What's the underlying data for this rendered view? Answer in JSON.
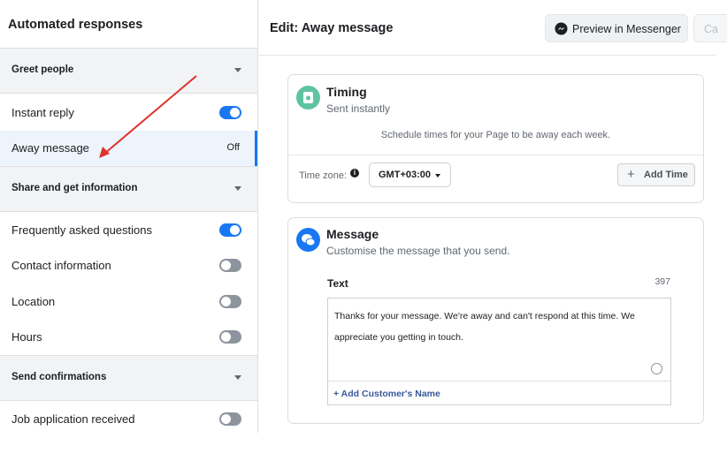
{
  "sidebar": {
    "title": "Automated responses",
    "sections": [
      {
        "label": "Greet people"
      },
      {
        "label": "Share and get information"
      },
      {
        "label": "Send confirmations"
      }
    ],
    "items": [
      {
        "label": "Instant reply",
        "toggle": "on"
      },
      {
        "label": "Away message",
        "status": "Off",
        "selected": true
      },
      {
        "label": "Frequently asked questions",
        "toggle": "on"
      },
      {
        "label": "Contact information",
        "toggle": "off"
      },
      {
        "label": "Location",
        "toggle": "off"
      },
      {
        "label": "Hours",
        "toggle": "off"
      },
      {
        "label": "Job application received",
        "toggle": "off"
      }
    ]
  },
  "header": {
    "title": "Edit: Away message",
    "preview_label": "Preview in Messenger",
    "preview_icon": "messenger-icon",
    "cancel_label": "Ca"
  },
  "timing": {
    "title": "Timing",
    "subtitle": "Sent instantly",
    "icon": "clock-icon",
    "schedule_text": "Schedule times for your Page to be away each week.",
    "timezone_label": "Time zone:",
    "timezone_value": "GMT+03:00",
    "add_time_label": "Add Time"
  },
  "message": {
    "title": "Message",
    "subtitle": "Customise the message that you send.",
    "icon": "chat-bubble-icon",
    "text_label": "Text",
    "char_count": "397",
    "text_value": "Thanks for your message. We're away and can't respond at this time. We appreciate you getting in touch.",
    "add_name_label": "+ Add Customer's Name"
  },
  "colors": {
    "accent": "#1877f2",
    "timing_icon": "#5ec3a1",
    "annotation_arrow": "#e0322b"
  }
}
